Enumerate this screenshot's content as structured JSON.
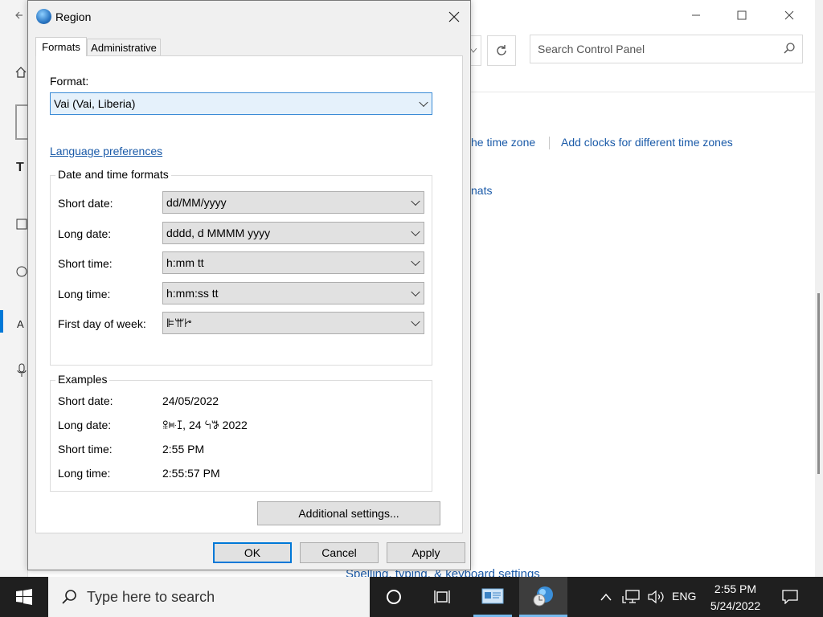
{
  "background_window": {
    "search_placeholder": "Search Control Panel",
    "links": [
      "he time zone",
      "Add clocks for different time zones",
      "nats"
    ],
    "partial_link_bottom": "Spelling, typing, & keyboard settings"
  },
  "dialog": {
    "title": "Region",
    "tabs": [
      "Formats",
      "Administrative"
    ],
    "active_tab": "Formats",
    "format_label": "Format:",
    "format_value": "Vai (Vai, Liberia)",
    "language_link": "Language preferences",
    "date_time_group": {
      "title": "Date and time formats",
      "rows": [
        {
          "label": "Short date:",
          "value": "dd/MM/yyyy"
        },
        {
          "label": "Long date:",
          "value": "dddd, d MMMM yyyy"
        },
        {
          "label": "Short time:",
          "value": "h:mm tt"
        },
        {
          "label": "Long time:",
          "value": "h:mm:ss tt"
        },
        {
          "label": "First day of week:",
          "value": "ꕞꕌꔵ"
        }
      ]
    },
    "examples_group": {
      "title": "Examples",
      "rows": [
        {
          "label": "Short date:",
          "value": "24/05/2022"
        },
        {
          "label": "Long date:",
          "value": "ꕉꔜꕯ, 24 ꕪꖃ 2022"
        },
        {
          "label": "Short time:",
          "value": "2:55 PM"
        },
        {
          "label": "Long time:",
          "value": "2:55:57 PM"
        }
      ]
    },
    "additional_settings": "Additional settings...",
    "buttons": {
      "ok": "OK",
      "cancel": "Cancel",
      "apply": "Apply"
    }
  },
  "taskbar": {
    "search_placeholder": "Type here to search",
    "language": "ENG",
    "time": "2:55 PM",
    "date": "5/24/2022"
  },
  "colors": {
    "accent": "#0078d7",
    "link": "#1a5aa8",
    "taskbar": "#1f1f1f"
  }
}
